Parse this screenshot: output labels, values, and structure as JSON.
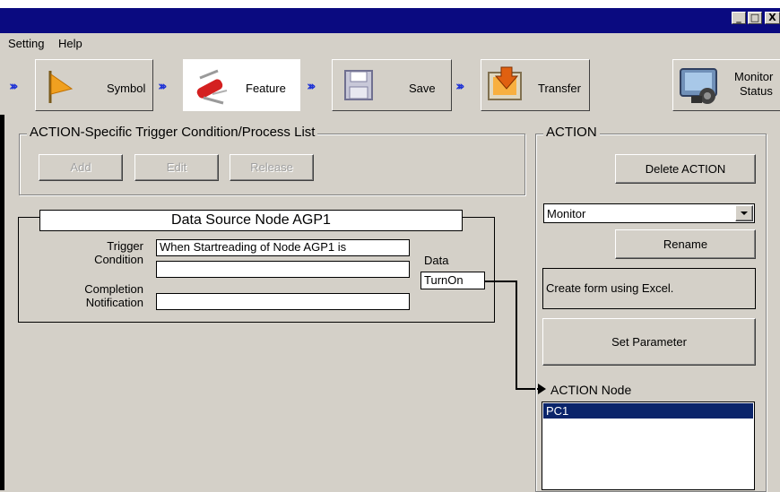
{
  "window": {
    "controls": [
      "_",
      "□",
      "X"
    ]
  },
  "menu": {
    "items": [
      "Setting",
      "Help"
    ]
  },
  "toolbar": {
    "steps": [
      {
        "label": "Symbol",
        "icon": "flag-icon"
      },
      {
        "label": "Feature",
        "icon": "swiss-knife-icon"
      },
      {
        "label": "Save",
        "icon": "floppy-disk-icon"
      },
      {
        "label": "Transfer",
        "icon": "transfer-icon"
      }
    ],
    "monitor": {
      "line1": "Monitor",
      "line2": "Status",
      "icon": "monitor-camera-icon"
    }
  },
  "trigger_panel": {
    "title": "ACTION-Specific Trigger Condition/Process List",
    "buttons": {
      "add": "Add",
      "edit": "Edit",
      "release": "Release"
    }
  },
  "data_source": {
    "title": "Data Source Node AGP1",
    "trigger_label_1": "Trigger",
    "trigger_label_2": "Condition",
    "trigger_value_1": "When Startreading of Node AGP1 is",
    "trigger_value_2": "",
    "completion_label_1": "Completion",
    "completion_label_2": "Notification",
    "completion_value": "",
    "data_label": "Data",
    "data_value": "TurnOn"
  },
  "action_panel": {
    "title": "ACTION",
    "delete_button": "Delete ACTION",
    "selected_action": "Monitor",
    "rename_button": "Rename",
    "description": "Create form using Excel.",
    "set_parameter_button": "Set Parameter",
    "node_label": "ACTION Node",
    "nodes": [
      "PC1"
    ]
  },
  "colors": {
    "titlebar": "#0a0a80",
    "chevron": "#1a2fd6",
    "selection": "#0a246a"
  }
}
